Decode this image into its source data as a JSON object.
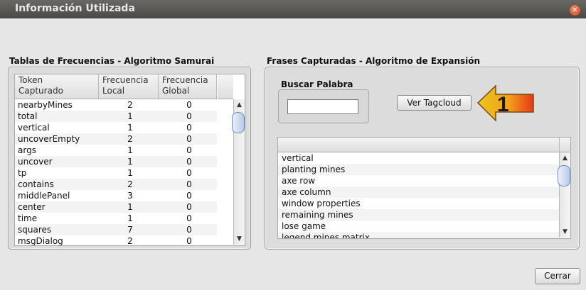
{
  "window": {
    "title": "Información Utilizada",
    "close_icon": "close-icon"
  },
  "left": {
    "title": "Tablas de Frecuencias - Algoritmo Samurai",
    "columns": [
      {
        "line1": "Token",
        "line2": "Capturado"
      },
      {
        "line1": "Frecuencia",
        "line2": "Local"
      },
      {
        "line1": "Frecuencia",
        "line2": "Global"
      }
    ],
    "rows": [
      {
        "token": "nearbyMines",
        "local": "2",
        "global": "0"
      },
      {
        "token": "total",
        "local": "1",
        "global": "0"
      },
      {
        "token": "vertical",
        "local": "1",
        "global": "0"
      },
      {
        "token": "uncoverEmpty",
        "local": "2",
        "global": "0"
      },
      {
        "token": "args",
        "local": "1",
        "global": "0"
      },
      {
        "token": "uncover",
        "local": "1",
        "global": "0"
      },
      {
        "token": "tp",
        "local": "1",
        "global": "0"
      },
      {
        "token": "contains",
        "local": "2",
        "global": "0"
      },
      {
        "token": "middlePanel",
        "local": "3",
        "global": "0"
      },
      {
        "token": "center",
        "local": "1",
        "global": "0"
      },
      {
        "token": "time",
        "local": "1",
        "global": "0"
      },
      {
        "token": "squares",
        "local": "7",
        "global": "0"
      },
      {
        "token": "msgDialog",
        "local": "2",
        "global": "0"
      }
    ]
  },
  "right": {
    "title": "Frases Capturadas - Algoritmo de Expansión",
    "search_label": "Buscar Palabra",
    "search_value": "",
    "tagcloud_button": "Ver Tagcloud",
    "callout_number": "1",
    "phrases": [
      "vertical",
      "planting mines",
      "axe row",
      "axe column",
      "window properties",
      "remaining mines",
      "lose game",
      "legend mines matrix"
    ]
  },
  "footer": {
    "close_button": "Cerrar"
  }
}
